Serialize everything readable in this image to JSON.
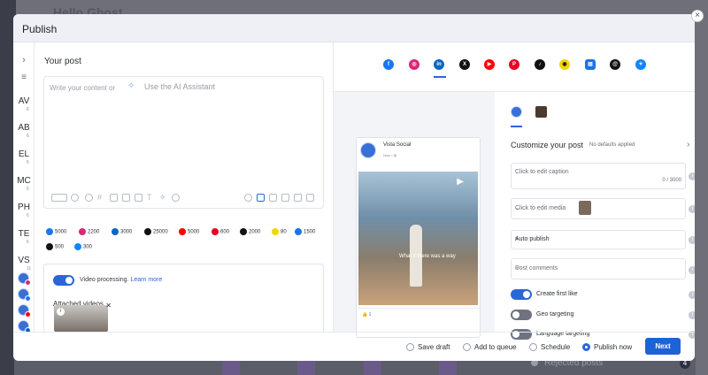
{
  "background": {
    "title": "Hello Ghost",
    "rejected_label": "Rejected posts"
  },
  "modal": {
    "title": "Publish",
    "close_label": "×"
  },
  "sidebar": {
    "items": [
      {
        "label": "AV",
        "count": "6"
      },
      {
        "label": "AB",
        "count": "6"
      },
      {
        "label": "EL",
        "count": "6"
      },
      {
        "label": "MC",
        "count": "6"
      },
      {
        "label": "PH",
        "count": "6"
      },
      {
        "label": "TE",
        "count": "6"
      },
      {
        "label": "VS",
        "count": "11"
      }
    ]
  },
  "left": {
    "heading": "Your post",
    "editor_placeholder": "Write your content or",
    "ai_label": "Use the AI Assistant",
    "video_processing_label": "Video processing.",
    "learn_more_label": "Learn more",
    "attached_videos_label": "Attached videos",
    "counts": [
      {
        "network": "facebook",
        "value": "5000",
        "color": "#1877f2"
      },
      {
        "network": "instagram",
        "value": "2200",
        "color": "#d62976"
      },
      {
        "network": "linkedin",
        "value": "3000",
        "color": "#0a66c2"
      },
      {
        "network": "x",
        "value": "25000",
        "color": "#111111"
      },
      {
        "network": "youtube",
        "value": "5000",
        "color": "#ff0000"
      },
      {
        "network": "pinterest",
        "value": "600",
        "color": "#e60023"
      },
      {
        "network": "tiktok",
        "value": "2000",
        "color": "#111111"
      },
      {
        "network": "snapchat",
        "value": "80",
        "color": "#fffc00"
      },
      {
        "network": "google",
        "value": "1500",
        "color": "#1a73e8"
      },
      {
        "network": "threads",
        "value": "500",
        "color": "#111111"
      },
      {
        "network": "bluesky",
        "value": "300",
        "color": "#1185fe"
      }
    ]
  },
  "right": {
    "networks": [
      {
        "name": "facebook",
        "glyph": "f",
        "color": "#1877f2"
      },
      {
        "name": "instagram",
        "glyph": "◎",
        "color": "#d62976"
      },
      {
        "name": "linkedin",
        "glyph": "in",
        "color": "#0a66c2"
      },
      {
        "name": "x",
        "glyph": "X",
        "color": "#111111"
      },
      {
        "name": "youtube",
        "glyph": "▶",
        "color": "#ff0000"
      },
      {
        "name": "pinterest",
        "glyph": "P",
        "color": "#e60023"
      },
      {
        "name": "tiktok",
        "glyph": "♪",
        "color": "#111111"
      },
      {
        "name": "snapchat",
        "glyph": "◉",
        "color": "#f2d600"
      },
      {
        "name": "google",
        "glyph": "▤",
        "color": "#1a73e8"
      },
      {
        "name": "threads",
        "glyph": "@",
        "color": "#111111"
      },
      {
        "name": "bluesky",
        "glyph": "✦",
        "color": "#1185fe"
      }
    ],
    "preview": {
      "account_name": "Vista Social",
      "account_sub": "Now • ◍",
      "caption_overlay": "What if there was a way",
      "likes": "👍 1"
    },
    "customize_title": "Customize your post",
    "no_defaults": "No defaults applied",
    "caption_placeholder": "Click to edit caption",
    "caption_counter": "0 / 3000",
    "media_placeholder": "Click to edit media",
    "publish_mode": "Auto publish",
    "post_comments": "Post comments",
    "create_first_like": "Create first like",
    "geo_targeting": "Geo targeting",
    "language_targeting": "Language targeting"
  },
  "footer": {
    "options": [
      {
        "label": "Save draft",
        "checked": false
      },
      {
        "label": "Add to queue",
        "checked": false
      },
      {
        "label": "Schedule",
        "checked": false
      },
      {
        "label": "Publish now",
        "checked": true
      }
    ],
    "next_label": "Next"
  }
}
